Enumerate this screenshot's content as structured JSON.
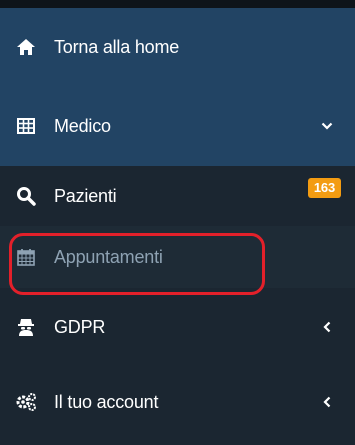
{
  "sidebar": {
    "items": [
      {
        "label": "Torna alla home",
        "icon": "home-icon"
      },
      {
        "label": "Medico",
        "icon": "table-icon"
      },
      {
        "label": "Pazienti",
        "icon": "search-icon",
        "badge": "163"
      },
      {
        "label": "Appuntamenti",
        "icon": "calendar-icon"
      },
      {
        "label": "GDPR",
        "icon": "user-secret-icon"
      },
      {
        "label": "Il tuo account",
        "icon": "gears-icon"
      }
    ]
  },
  "colors": {
    "sidebar_bg": "#1b2631",
    "active_bg": "#224464",
    "badge_bg": "#f39c12",
    "muted_text": "#8ea2b3",
    "annotation": "#e3202a"
  }
}
